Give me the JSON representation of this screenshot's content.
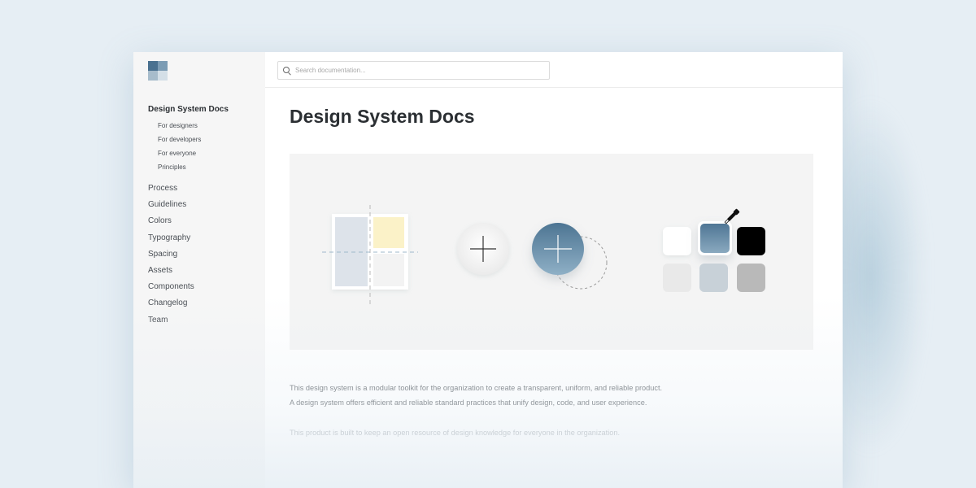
{
  "search": {
    "placeholder": "Search documentation..."
  },
  "sidebar": {
    "title": "Design System Docs",
    "sub_items": [
      {
        "label": "For designers"
      },
      {
        "label": "For developers"
      },
      {
        "label": "For everyone"
      },
      {
        "label": "Principles"
      }
    ],
    "items": [
      {
        "label": "Process"
      },
      {
        "label": "Guidelines"
      },
      {
        "label": "Colors"
      },
      {
        "label": "Typography"
      },
      {
        "label": "Spacing"
      },
      {
        "label": "Assets"
      },
      {
        "label": "Components"
      },
      {
        "label": "Changelog"
      },
      {
        "label": "Team"
      }
    ]
  },
  "main": {
    "title": "Design System Docs",
    "paragraphs": [
      "This design system is a modular toolkit for the organization to create a transparent, uniform, and reliable product.",
      "A design system offers efficient and reliable standard practices that unify design, code, and user experience.",
      "This product is built to keep an open resource of design knowledge for everyone in the organization."
    ]
  },
  "colors": {
    "brand_dark": "#4a7190",
    "brand_light": "#7c9cb4",
    "swatches": [
      "#ffffff",
      "#6a8ea8",
      "#000000",
      "#e9e9e9",
      "#c8d1d8",
      "#b9b9b9"
    ]
  }
}
